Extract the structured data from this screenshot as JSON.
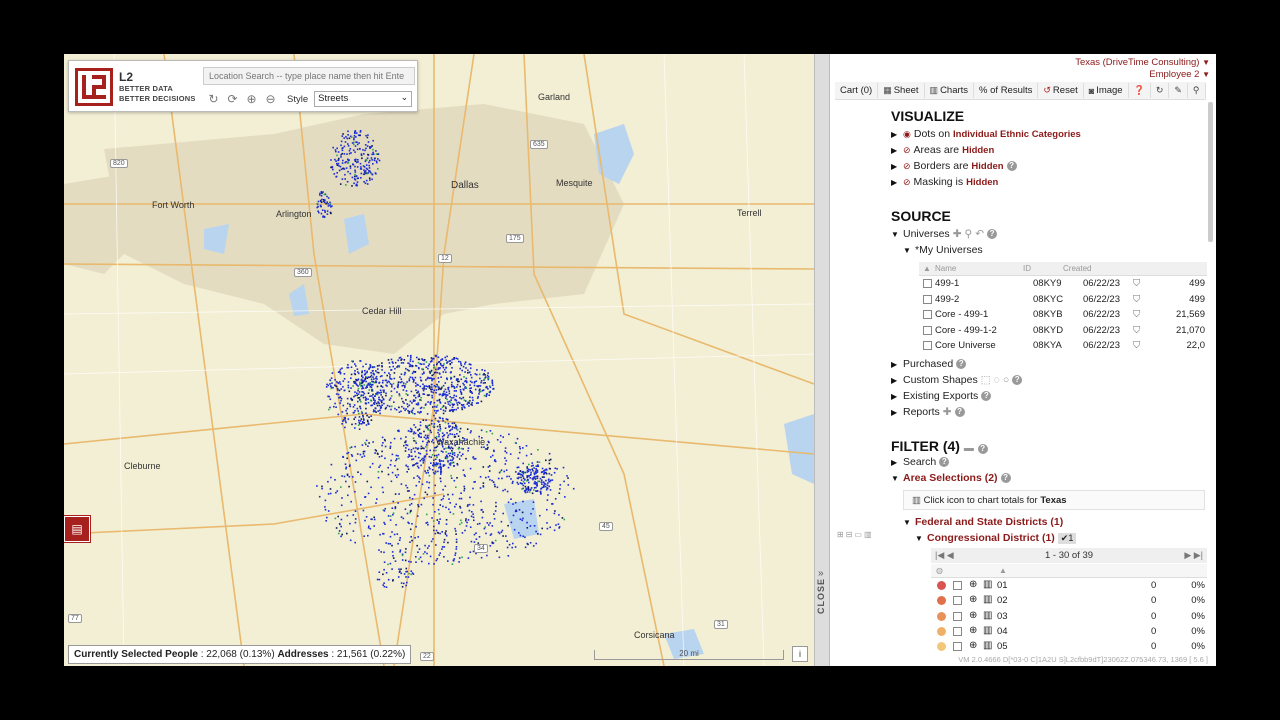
{
  "map": {
    "logo": {
      "mark": "L2",
      "tagline1": "BETTER DATA",
      "tagline2": "BETTER DECISIONS"
    },
    "location_search_placeholder": "Location Search -- type place name then hit Ente",
    "style_label": "Style",
    "style_value": "Streets",
    "labels": {
      "garland": "Garland",
      "fort_worth": "Fort Worth",
      "arlington": "Arlington",
      "dallas": "Dallas",
      "mesquite": "Mesquite",
      "terrell": "Terrell",
      "cedar_hill": "Cedar Hill",
      "waxahachie": "Waxahachie",
      "cleburne": "Cleburne",
      "corsicana": "Corsicana"
    },
    "shields": [
      "820",
      "635",
      "175",
      "12",
      "360",
      "45",
      "34",
      "31",
      "22",
      "77"
    ],
    "status": {
      "people_label": "Currently Selected People",
      "people_value": ": 22,068 (0.13%)",
      "addresses_label": "Addresses",
      "addresses_value": ": 21,561 (0.22%)"
    },
    "scale_label": "20 mi",
    "info_label": "i"
  },
  "divider": {
    "close_label": "CLOSE"
  },
  "panel": {
    "account": "Texas (DriveTime Consulting)",
    "user": "Employee 2",
    "toolbar": {
      "cart": "Cart (0)",
      "sheet": "Sheet",
      "charts": "Charts",
      "pct": "% of Results",
      "reset": "Reset",
      "image": "Image"
    },
    "visualize": {
      "title": "VISUALIZE",
      "dots_pre": "Dots on",
      "dots_val": "Individual Ethnic Categories",
      "areas_pre": "Areas are",
      "areas_val": "Hidden",
      "borders_pre": "Borders are",
      "borders_val": "Hidden",
      "masking_pre": "Masking is",
      "masking_val": "Hidden"
    },
    "source": {
      "title": "SOURCE",
      "universes": "Universes",
      "my_universes": "*My Universes",
      "cols": {
        "name": "Name",
        "id": "ID",
        "created": "Created"
      },
      "rows": [
        {
          "name": "499-1",
          "id": "08KY9",
          "created": "06/22/23",
          "count": "499"
        },
        {
          "name": "499-2",
          "id": "08KYC",
          "created": "06/22/23",
          "count": "499"
        },
        {
          "name": "Core - 499-1",
          "id": "08KYB",
          "created": "06/22/23",
          "count": "21,569"
        },
        {
          "name": "Core - 499-1-2",
          "id": "08KYD",
          "created": "06/22/23",
          "count": "21,070"
        },
        {
          "name": "Core Universe",
          "id": "08KYA",
          "created": "06/22/23",
          "count": "22,0"
        }
      ],
      "purchased": "Purchased",
      "custom_shapes": "Custom Shapes",
      "existing_exports": "Existing Exports",
      "reports": "Reports"
    },
    "filter": {
      "title": "FILTER (4)",
      "search": "Search",
      "area_selections": "Area Selections (2)",
      "chart_note_pre": "Click icon to chart totals for",
      "chart_note_val": "Texas",
      "fed_state": "Federal and State Districts (1)",
      "congressional": "Congressional District (1)",
      "badge": "✔1",
      "pager": "1 - 30 of 39",
      "districts": [
        {
          "name": "01",
          "count": "0",
          "pct": "0%",
          "color": "#d9534f"
        },
        {
          "name": "02",
          "count": "0",
          "pct": "0%",
          "color": "#e0704a"
        },
        {
          "name": "03",
          "count": "0",
          "pct": "0%",
          "color": "#e8925a"
        },
        {
          "name": "04",
          "count": "0",
          "pct": "0%",
          "color": "#efb16a"
        },
        {
          "name": "05",
          "count": "0",
          "pct": "0%",
          "color": "#f2c77a"
        }
      ]
    },
    "version": "VM 2.0.4666 D[*03-0 C]1A2U S]L2cfbb9dT]23062Z.075346.73, 1369 [ 5.6 ]"
  }
}
